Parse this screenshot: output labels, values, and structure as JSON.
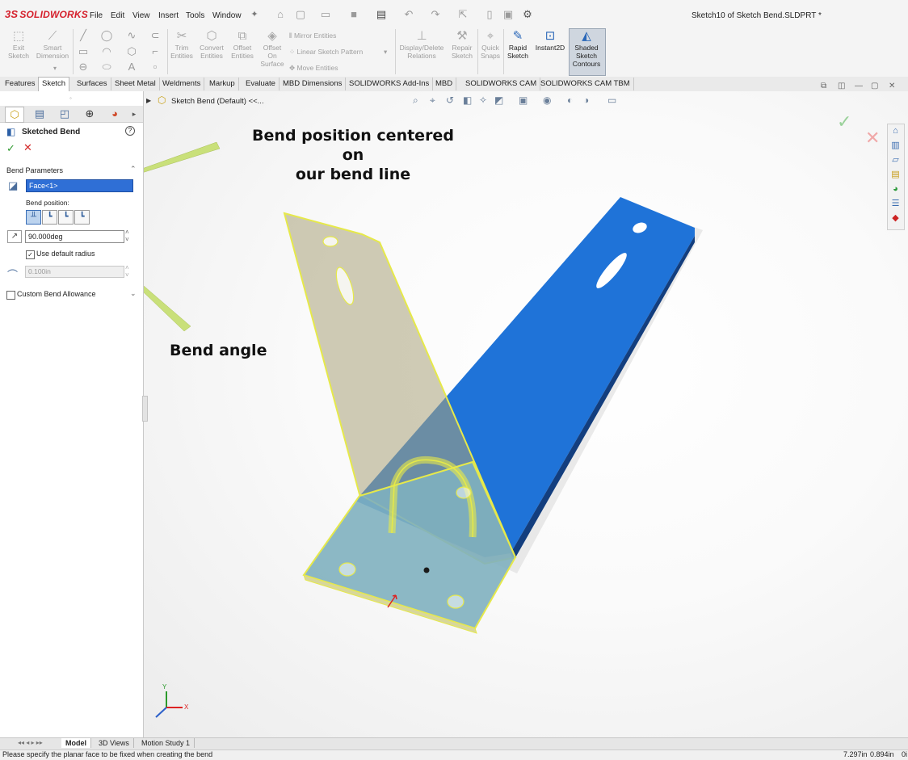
{
  "app": {
    "logo_text": "SOLIDWORKS",
    "logo_mark": "3S",
    "document_title": "Sketch10 of Sketch Bend.SLDPRT *"
  },
  "menu": [
    "File",
    "Edit",
    "View",
    "Insert",
    "Tools",
    "Window"
  ],
  "commands": {
    "exit_sketch": [
      "Exit",
      "Sketch"
    ],
    "smart_dimension": [
      "Smart",
      "Dimension"
    ],
    "trim_entities": [
      "Trim",
      "Entities"
    ],
    "convert_entities": [
      "Convert",
      "Entities"
    ],
    "offset_entities": [
      "Offset",
      "Entities"
    ],
    "offset_on_surface": [
      "Offset",
      "On",
      "Surface"
    ],
    "mirror_entities": "Mirror Entities",
    "linear_sketch_pattern": "Linear Sketch Pattern",
    "move_entities": "Move Entities",
    "display_delete_relations": [
      "Display/Delete",
      "Relations"
    ],
    "repair_sketch": [
      "Repair",
      "Sketch"
    ],
    "quick_snaps": [
      "Quick",
      "Snaps"
    ],
    "rapid_sketch": [
      "Rapid",
      "Sketch"
    ],
    "instant2d": "Instant2D",
    "shaded_sketch_contours": [
      "Shaded",
      "Sketch",
      "Contours"
    ]
  },
  "tabs": [
    "Features",
    "Sketch",
    "Surfaces",
    "Sheet Metal",
    "Weldments",
    "Markup",
    "Evaluate",
    "MBD Dimensions",
    "SOLIDWORKS Add-Ins",
    "MBD",
    "SOLIDWORKS CAM",
    "SOLIDWORKS CAM TBM"
  ],
  "active_tab": "Sketch",
  "property_manager": {
    "title": "Sketched Bend",
    "group_title": "Bend Parameters",
    "face_value": "Face<1>",
    "bend_position_label": "Bend position:",
    "angle_value": "90.000deg",
    "use_default_radius_label": "Use default radius",
    "use_default_radius_checked": true,
    "radius_value": "0.100in",
    "custom_bend_allowance_label": "Custom Bend Allowance",
    "custom_bend_allowance_checked": false
  },
  "tree": {
    "label": "Sketch Bend (Default) <<..."
  },
  "annotations": {
    "bend_position": [
      "Bend position centered on",
      "our bend line"
    ],
    "bend_angle": "Bend angle"
  },
  "triad": {
    "x": "X",
    "y": "Y"
  },
  "bottom_tabs": [
    "Model",
    "3D Views",
    "Motion Study 1"
  ],
  "status": {
    "message": "Please specify the planar face to be fixed when creating the bend",
    "x": "7.297in",
    "y": "0.894in",
    "z": "0i"
  },
  "colors": {
    "accent": "#2f6fd6",
    "part_blue": "#1f73d8",
    "highlight_yellow": "#e6e94a",
    "annotation_arrow": "#c9e07a"
  }
}
